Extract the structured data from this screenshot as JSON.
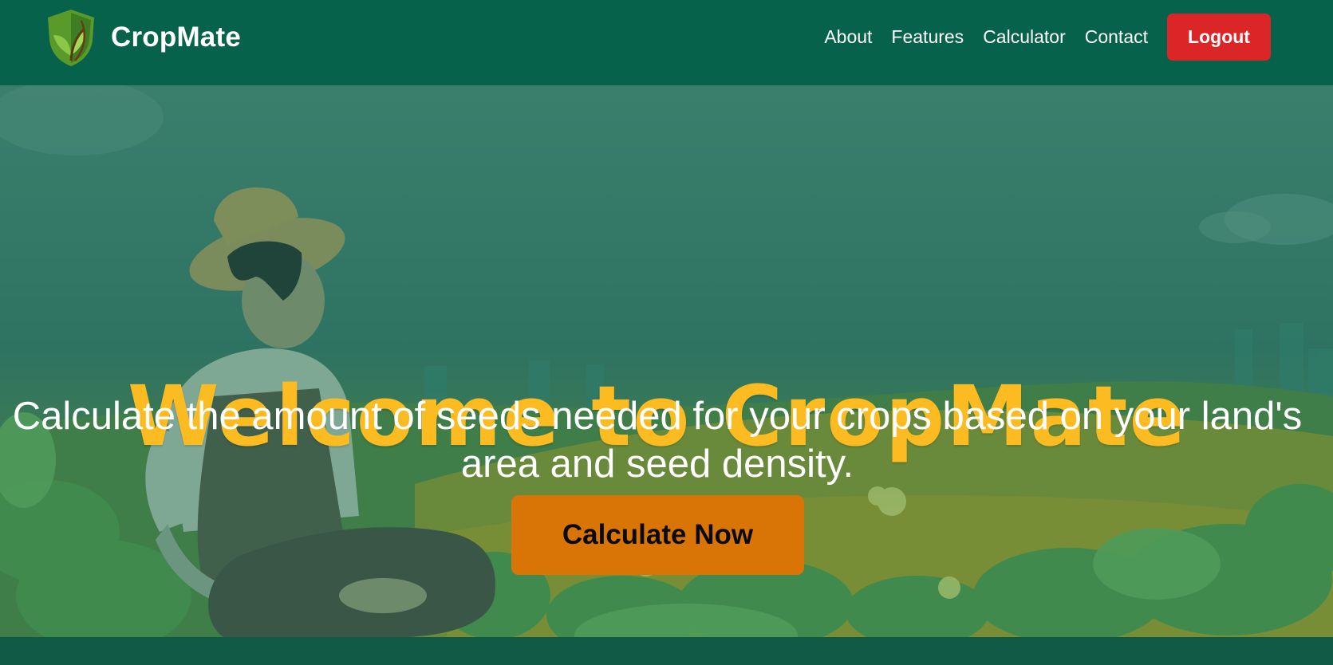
{
  "brand": {
    "name": "CropMate",
    "logo_icon": "shield-leaf-icon"
  },
  "nav": {
    "links": [
      "About",
      "Features",
      "Calculator",
      "Contact"
    ],
    "logout_label": "Logout"
  },
  "hero": {
    "title": "Welcome to CropMate",
    "subtitle": "Calculate the amount of seeds needed for your crops based on your land's area and seed density.",
    "cta_label": "Calculate Now",
    "illustration_icon": "farmer-illustration"
  },
  "colors": {
    "navbar": "#06624b",
    "title": "#fbbb21",
    "cta": "#d97506",
    "logout": "#dc2527"
  }
}
